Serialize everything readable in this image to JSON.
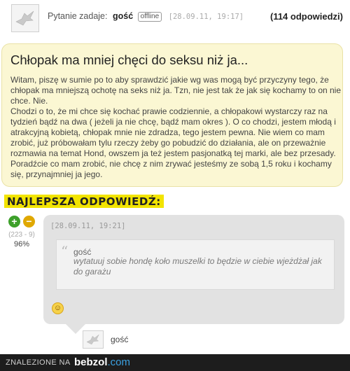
{
  "question": {
    "asked_by_label": "Pytanie zadaje:",
    "user": "gość",
    "status": "offline",
    "date": "[28.09.11, 19:17]",
    "answers_count": "(114 odpowiedzi)",
    "title": "Chłopak ma mniej chęci do seksu niż ja...",
    "body": [
      "Witam, piszę w sumie po to aby sprawdzić jakie wg was mogą być przyczyny tego, że chłopak ma mniejszą ochotę na seks niż ja. Tzn, nie jest tak że jak się kochamy to on nie chce. Nie.",
      "Chodzi o to, że mi chce się kochać prawie codziennie, a chłopakowi wystarczy raz na tydzień bądź na dwa ( jeżeli ja nie chcę, bądź mam okres ). O co chodzi, jestem młodą i atrakcyjną kobietą, chłopak mnie nie zdradza, tego jestem pewna. Nie wiem co mam zrobić, już próbowałam tylu rzeczy żeby go pobudzić do działania, ale on przeważnie rozmawia na temat Hond, owszem ja też jestem pasjonatką tej marki, ale bez przesady. Poradźcie co mam zrobić, nie chcę z nim zrywać jesteśmy ze sobą 1,5 roku i kochamy się, przynajmniej ja jego."
    ]
  },
  "best_answer": {
    "label": "NAJLEPSZA ODPOWIEDŹ:",
    "vote_plus": "+",
    "vote_minus": "−",
    "vote_count": "(223 - 9)",
    "vote_percent": "96%",
    "date": "[28.09.11, 19:21]",
    "quote_user": "gość",
    "quote_text": "wytatuuj sobie hondę koło muszelki to będzie w ciebie wjeżdżał jak do garażu",
    "author": "gość"
  },
  "footer": {
    "found_on": "ZNALEZIONE NA",
    "site": "bebzol",
    "tld": ".com"
  },
  "icons": [
    "avatar-bird-icon",
    "smiley-icon",
    "plus-vote-icon",
    "minus-vote-icon"
  ],
  "colors": {
    "question_bg": "#fbf7d3",
    "answer_bg": "#e2e2e2",
    "best_label_bg": "#f2e400",
    "vote_plus": "#3da02a",
    "vote_minus": "#e0a800",
    "footer_bg": "#1d1d1d"
  }
}
